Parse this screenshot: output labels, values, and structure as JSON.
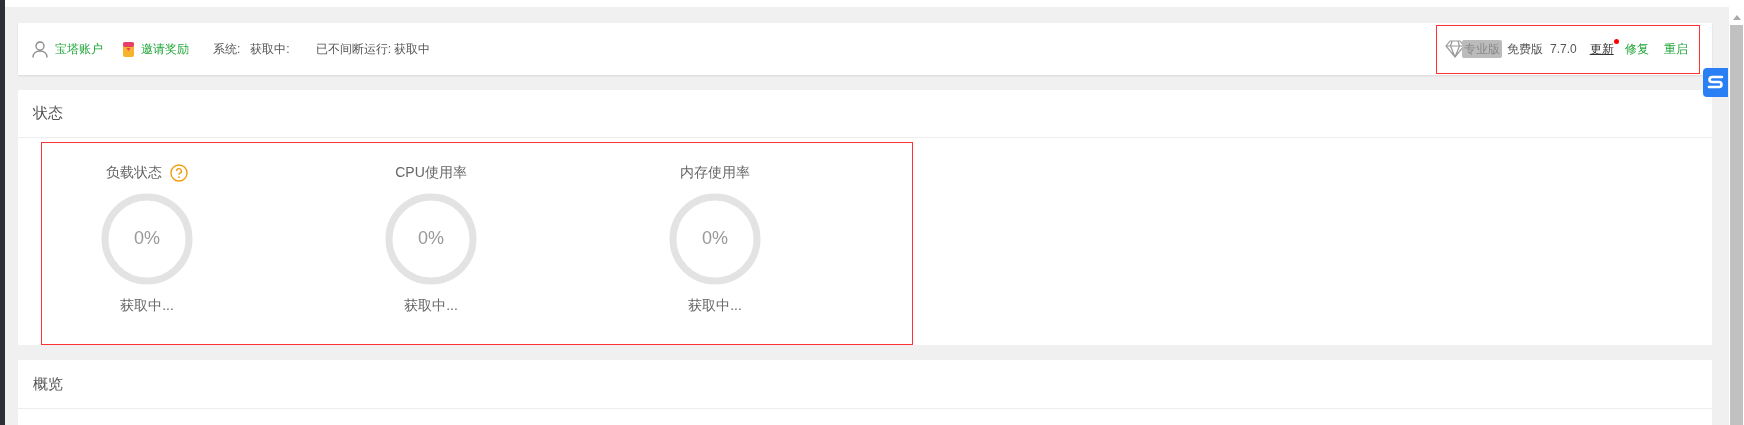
{
  "header": {
    "account": "宝塔账户",
    "invite": "邀请奖励",
    "system_label": "系统:",
    "system_value": "获取中:",
    "uptime": "已不间断运行: 获取中",
    "pro_badge": "专业版",
    "edition": "免费版",
    "version": "7.7.0",
    "update": {
      "label": "更新",
      "has_new": true
    },
    "repair": "修复",
    "restart": "重启"
  },
  "status": {
    "title": "状态",
    "gauges": [
      {
        "title": "负载状态",
        "help": true,
        "value": "0%",
        "level": 0,
        "caption": "获取中..."
      },
      {
        "title": "CPU使用率",
        "help": false,
        "value": "0%",
        "level": 0,
        "caption": "获取中..."
      },
      {
        "title": "内存使用率",
        "help": false,
        "value": "0%",
        "level": 0,
        "caption": "获取中..."
      }
    ]
  },
  "overview": {
    "title": "概览"
  }
}
